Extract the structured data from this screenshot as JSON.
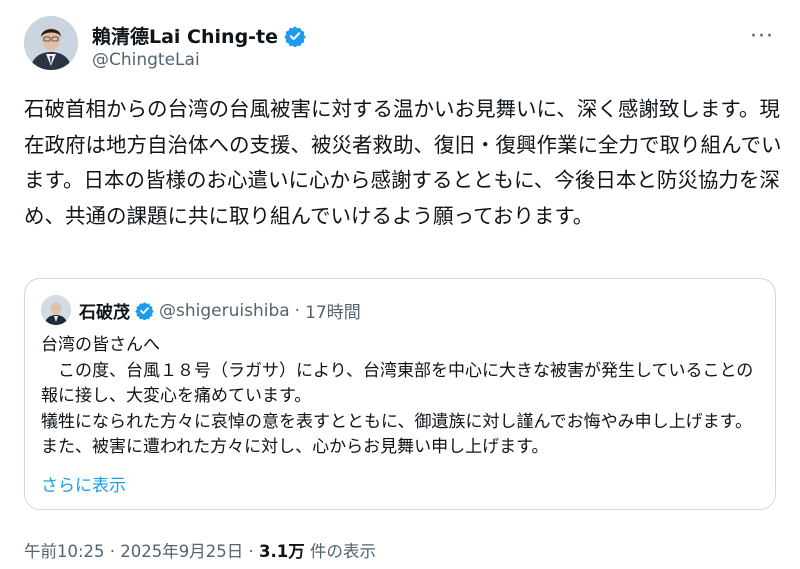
{
  "author": {
    "name": "賴清德Lai Ching-te",
    "handle": "@ChingteLai"
  },
  "more_menu": "···",
  "body_text": "石破首相からの台湾の台風被害に対する温かいお見舞いに、深く感謝致します。現在政府は地方自治体への支援、被災者救助、復旧・復興作業に全力で取り組んでいます。日本の皆様のお心遣いに心から感謝するとともに、今後日本と防災協力を深め、共通の課題に共に取り組んでいけるよう願っております。",
  "quote": {
    "name": "石破茂",
    "handle": "@shigeruishiba",
    "separator": "·",
    "time": "17時間",
    "text": "台湾の皆さんへ\n　この度、台風１８号（ラガサ）により、台湾東部を中心に大きな被害が発生していることの報に接し、大変心を痛めています。\n犠牲になられた方々に哀悼の意を表すとともに、御遺族に対し謹んでお悔やみ申し上げます。また、被害に遭われた方々に対し、心からお見舞い申し上げます。",
    "show_more": "さらに表示"
  },
  "footer": {
    "timestamp": "午前10:25 · 2025年9月25日 · ",
    "views_count": "3.1万",
    "views_label": " 件の表示"
  },
  "colors": {
    "verified": "#1d9bf0",
    "link": "#1d9bf0",
    "secondary_text": "#536471",
    "border": "#cfd9de"
  }
}
